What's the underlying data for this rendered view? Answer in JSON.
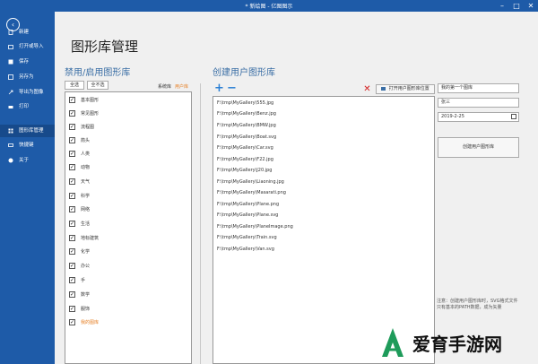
{
  "window": {
    "title": "* 新绘图 - 亿图图示"
  },
  "sidebar": {
    "back_icon": "back-arrow-icon",
    "items": [
      {
        "label": "新建",
        "icon": "new-doc-icon"
      },
      {
        "label": "打开或导入",
        "icon": "open-folder-icon"
      },
      {
        "label": "保存",
        "icon": "save-icon"
      },
      {
        "label": "另存为",
        "icon": "save-as-icon"
      },
      {
        "label": "导出为图像",
        "icon": "export-icon"
      },
      {
        "label": "打印",
        "icon": "print-icon"
      },
      {
        "label": "图形库管理",
        "icon": "library-icon"
      },
      {
        "label": "快捷键",
        "icon": "keyboard-icon"
      },
      {
        "label": "关于",
        "icon": "info-icon"
      }
    ]
  },
  "main": {
    "title": "图形库管理",
    "left_section": {
      "title": "禁用/启用图形库",
      "select_all": "全选",
      "select_none": "全不选",
      "tab_system": "系统库",
      "tab_user": "用户库",
      "libraries": [
        {
          "label": "基本图形",
          "checked": true
        },
        {
          "label": "常见图形",
          "checked": true
        },
        {
          "label": "流程图",
          "checked": true
        },
        {
          "label": "箭头",
          "checked": true
        },
        {
          "label": "人类",
          "checked": true
        },
        {
          "label": "动物",
          "checked": true
        },
        {
          "label": "天气",
          "checked": true
        },
        {
          "label": "科学",
          "checked": true
        },
        {
          "label": "网络",
          "checked": true
        },
        {
          "label": "生活",
          "checked": true
        },
        {
          "label": "地标建筑",
          "checked": true
        },
        {
          "label": "化学",
          "checked": true
        },
        {
          "label": "办公",
          "checked": true
        },
        {
          "label": "手",
          "checked": true
        },
        {
          "label": "数学",
          "checked": true
        },
        {
          "label": "服饰",
          "checked": true
        },
        {
          "label": "我的图库",
          "checked": true,
          "highlight": true
        }
      ]
    },
    "right_section": {
      "title": "创建用户图形库",
      "open_location_btn": "打开用户图形库位置",
      "files": [
        "F:\\tmp\\MyGallery\\555.jpg",
        "F:\\tmp\\MyGallery\\Benz.jpg",
        "F:\\tmp\\MyGallery\\BMW.jpg",
        "F:\\tmp\\MyGallery\\Boat.svg",
        "F:\\tmp\\MyGallery\\Car.svg",
        "F:\\tmp\\MyGallery\\F22.jpg",
        "F:\\tmp\\MyGallery\\J20.jpg",
        "F:\\tmp\\MyGallery\\Liaoning.jpg",
        "F:\\tmp\\MyGallery\\Masarati.png",
        "F:\\tmp\\MyGallery\\Plane.png",
        "F:\\tmp\\MyGallery\\Plane.svg",
        "F:\\tmp\\MyGallery\\PlaneImage.png",
        "F:\\tmp\\MyGallery\\Train.svg",
        "F:\\tmp\\MyGallery\\Van.svg"
      ],
      "gallery_name": "我的第一个图库",
      "author": "张三",
      "date": "2019-2-25",
      "create_btn": "创建用户图形库",
      "note": "注意：创建用户图形库时，SVG格式文件只有基本的PATH数据，成为矢量"
    }
  },
  "watermark": {
    "text": "爱育手游网"
  },
  "colors": {
    "accent": "#1e5ba8",
    "highlight": "#e67e22",
    "delete": "#d32020"
  }
}
